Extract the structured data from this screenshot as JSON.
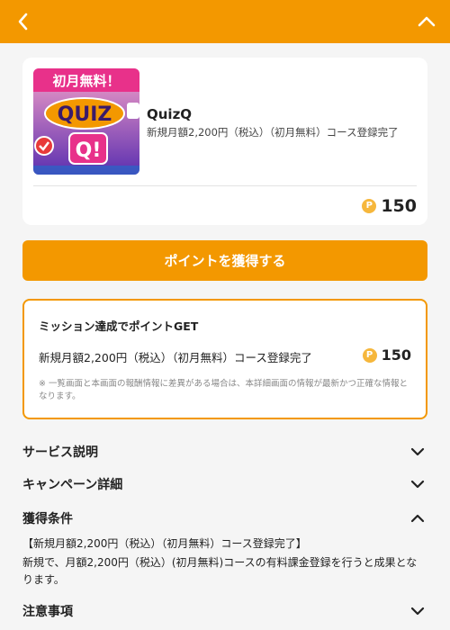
{
  "colors": {
    "accent": "#f39800",
    "coin": "#f6b73c"
  },
  "header": {
    "back_icon": "chevron-left-icon",
    "collapse_icon": "chevron-up-icon"
  },
  "offer": {
    "thumbnail": {
      "banner_text": "初月無料！",
      "logo_line1": "QUIZ",
      "logo_line2": "Q!"
    },
    "name": "QuizQ",
    "description": "新規月額2,200円（税込）（初月無料）コース登録完了",
    "points": "150",
    "coin_symbol": "P"
  },
  "cta": {
    "label": "ポイントを獲得する"
  },
  "mission": {
    "title": "ミッション達成でポイントGET",
    "rows": [
      {
        "label": "新規月額2,200円（税込）（初月無料）コース登録完了",
        "points": "150"
      }
    ],
    "note": "※ 一覧画面と本画面の報酬情報に差異がある場合は、本詳細画面の情報が最新かつ正確な情報となります。"
  },
  "sections": [
    {
      "label": "サービス説明",
      "expanded": false
    },
    {
      "label": "キャンペーン詳細",
      "expanded": false
    },
    {
      "label": "獲得条件",
      "expanded": true
    },
    {
      "label": "注意事項",
      "expanded": false
    }
  ],
  "conditions": {
    "title": "【新規月額2,200円（税込）（初月無料）コース登録完了】",
    "body": "新規で、月額2,200円（税込）(初月無料)コースの有料課金登録を行うと成果となります。"
  }
}
